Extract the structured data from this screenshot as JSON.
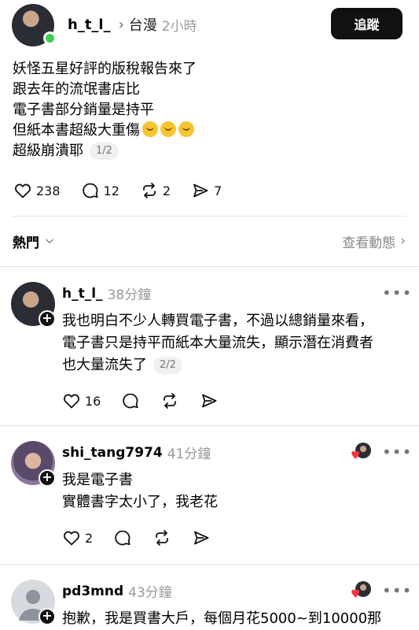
{
  "post": {
    "username": "h_t_l_",
    "topic": "台漫",
    "time": "2小時",
    "follow_label": "追蹤",
    "lines": [
      "妖怪五星好評的版稅報告來了",
      "跟去年的流氓書店比",
      "電子書部分銷量是持平",
      "但紙本書超級大重傷",
      "超級崩潰耶"
    ],
    "pager": "1/2",
    "likes": "238",
    "comments": "12",
    "reposts": "2",
    "shares": "7"
  },
  "sort": {
    "label": "熱門",
    "activity_label": "查看動態"
  },
  "replies": [
    {
      "username": "h_t_l_",
      "time": "38分鐘",
      "lines": [
        "我也明白不少人轉買電子書，不過以總銷量來看，",
        "電子書只是持平而紙本大量流失，顯示潛在消費者",
        "也大量流失了"
      ],
      "pager": "2/2",
      "likes": "16"
    },
    {
      "username": "shi_tang7974",
      "time": "41分鐘",
      "lines": [
        "我是電子書",
        "實體書字太小了，我老花"
      ],
      "likes": "2"
    },
    {
      "username": "pd3mnd",
      "time": "43分鐘",
      "lines": [
        "抱歉，我是買書大戶，每個月花5000~到10000那"
      ]
    }
  ],
  "colors": {
    "online": "#3ccf4e",
    "heart": "#ff3040",
    "muted": "#9a9a9a"
  }
}
